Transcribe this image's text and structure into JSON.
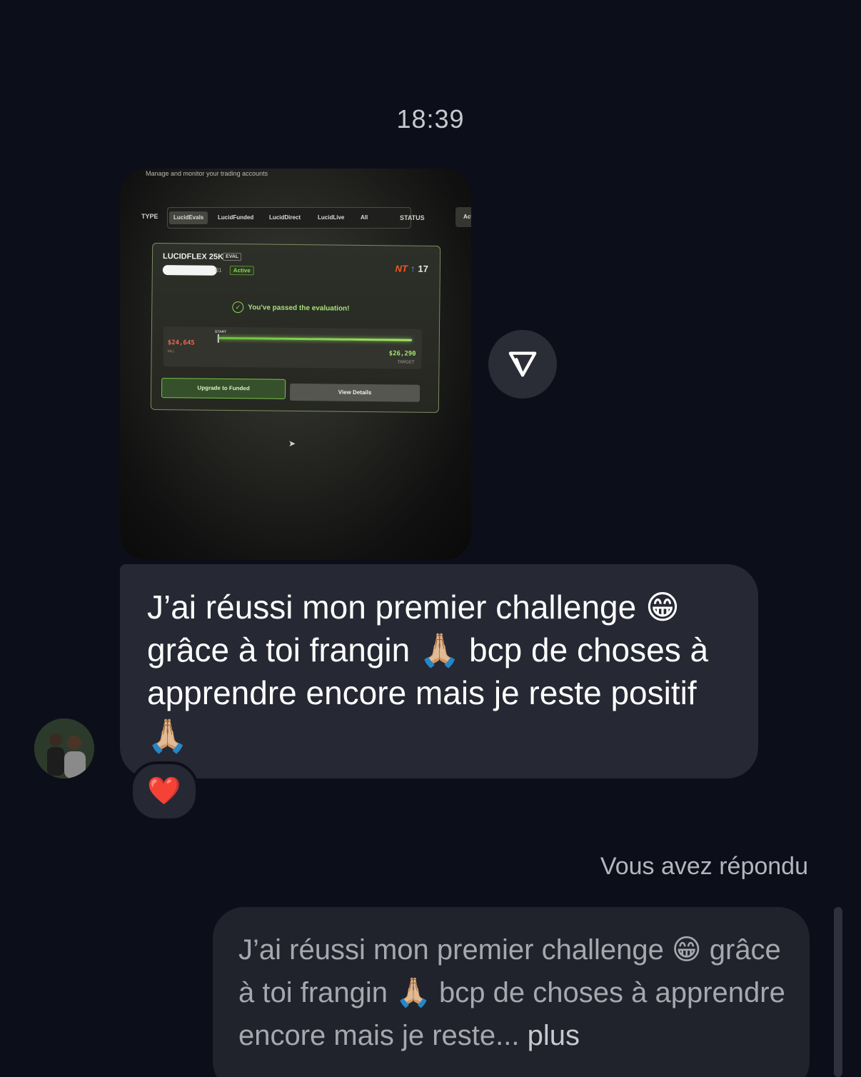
{
  "timestamp": "18:39",
  "photo": {
    "caption": "Manage and monitor your trading accounts",
    "filters": {
      "type_label": "TYPE",
      "tabs": [
        "LucidEvals",
        "LucidFunded",
        "LucidDirect",
        "LucidLive",
        "All"
      ],
      "active_tab": "LucidEvals",
      "status_label": "STATUS",
      "status_value": "Active"
    },
    "card": {
      "title": "LUCIDFLEX 25K",
      "badge": "EVAL",
      "account_suffix": "01",
      "status_badge": "Active",
      "logos": {
        "nt": "NT",
        "arrow": "↑",
        "tv": "17"
      },
      "passed_message": "You've passed the evaluation!",
      "start_label": "START",
      "mll_value": "$24,645",
      "mll_label": "MLL",
      "target_value": "$26,290",
      "target_label": "TARGET",
      "upgrade_button": "Upgrade to Funded",
      "details_button": "View Details"
    }
  },
  "message": {
    "text": "J’ai réussi mon premier challenge 😁 grâce à toi frangin 🙏🏼 bcp de choses à apprendre encore mais je reste positif 🙏🏼",
    "reaction": "❤️"
  },
  "reply": {
    "label": "Vous avez répondu",
    "quoted_text": "J’ai réussi mon premier challenge 😁 grâce à toi frangin 🙏🏼 bcp de choses à apprendre encore mais je reste...",
    "more_label": " plus"
  },
  "colors": {
    "background": "#0c0f1a",
    "bubble": "#262833",
    "accent_green": "#8fd45a",
    "heart": "#e8283a"
  }
}
